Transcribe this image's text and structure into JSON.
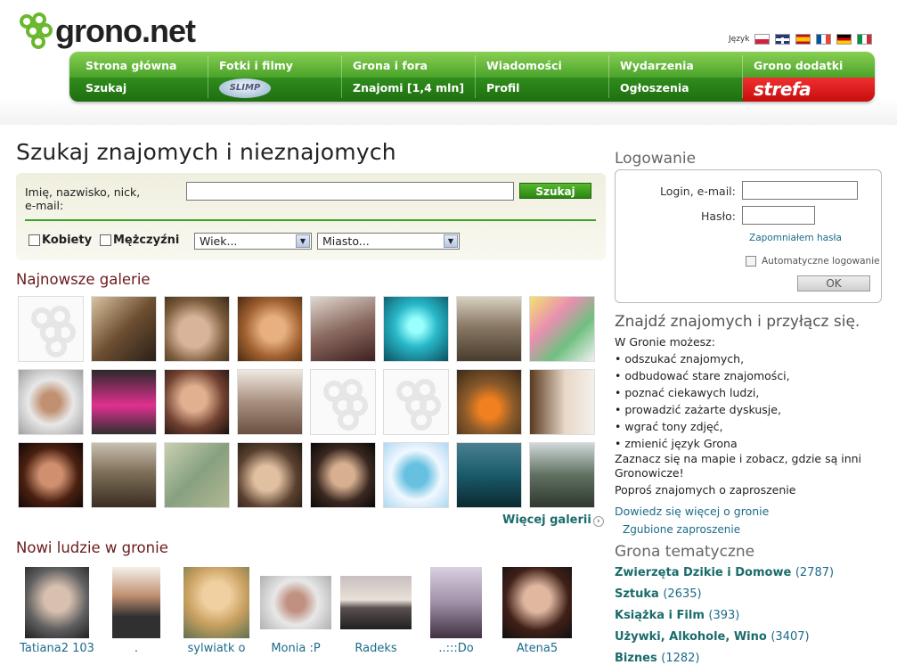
{
  "site": {
    "name": "grono.net",
    "accent": "#3aa323",
    "link_color": "#1b6b8b"
  },
  "language": {
    "label": "Język",
    "flags": [
      "pl-flag-icon",
      "en-flag-icon",
      "es-flag-icon",
      "fr-flag-icon",
      "de-flag-icon",
      "it-flag-icon"
    ]
  },
  "nav": {
    "row1": [
      "Strona główna",
      "Fotki i filmy",
      "Grona i fora",
      "Wiadomości",
      "Wydarzenia",
      "Grono dodatki"
    ],
    "row2": [
      "Szukaj",
      "Znajomi [1,4 mln]",
      "Profil",
      "Ogłoszenia"
    ],
    "slimp": "SLIMP",
    "strefa": "strefa"
  },
  "search": {
    "title": "Szukaj znajomych i nieznajomych",
    "name_label_line1": "Imię, nazwisko, nick,",
    "name_label_line2": "e-mail:",
    "name_value": "",
    "button": "Szukaj",
    "female": "Kobiety",
    "male": "Mężczyźni",
    "age_select": "Wiek...",
    "city_select": "Miasto..."
  },
  "galleries": {
    "title": "Najnowsze galerie",
    "more": "Więcej galerii"
  },
  "people": {
    "title": "Nowi ludzie w gronie",
    "items": [
      "Tatiana2 103",
      ".",
      "sylwiatk o",
      "Monia :P",
      "Radeks",
      "..:::Do",
      "Atena5"
    ]
  },
  "login": {
    "title": "Logowanie",
    "login_label": "Login, e-mail:",
    "password_label": "Hasło:",
    "forgot": "Zapomniałem hasła",
    "auto": "Automatyczne logowanie",
    "ok": "OK"
  },
  "info": {
    "title": "Znajdź znajomych i przyłącz się.",
    "intro": "W Gronie możesz:",
    "bullets": [
      "odszukać znajomych,",
      "odbudować stare znajomości,",
      "poznać ciekawych ludzi,",
      "prowadzić zażarte dyskusje,",
      "wgrać tony zdjęć,",
      "zmienić język Grona"
    ],
    "map_line1": "Zaznacz się na mapie i zobacz, gdzie są inni",
    "map_line2": "Gronowicze!",
    "invite": "Poproś znajomych o zaproszenie",
    "more": "Dowiedz się więcej o gronie",
    "lost": "Zgubione zaproszenie"
  },
  "groups": {
    "title": "Grona tematyczne",
    "items": [
      {
        "name": "Zwierzęta Dzikie i Domowe",
        "count": "(2787)"
      },
      {
        "name": "Sztuka",
        "count": "(2635)"
      },
      {
        "name": "Książka i Film",
        "count": "(393)"
      },
      {
        "name": "Używki, Alkohole, Wino",
        "count": "(3407)"
      },
      {
        "name": "Biznes",
        "count": "(1282)"
      }
    ]
  }
}
